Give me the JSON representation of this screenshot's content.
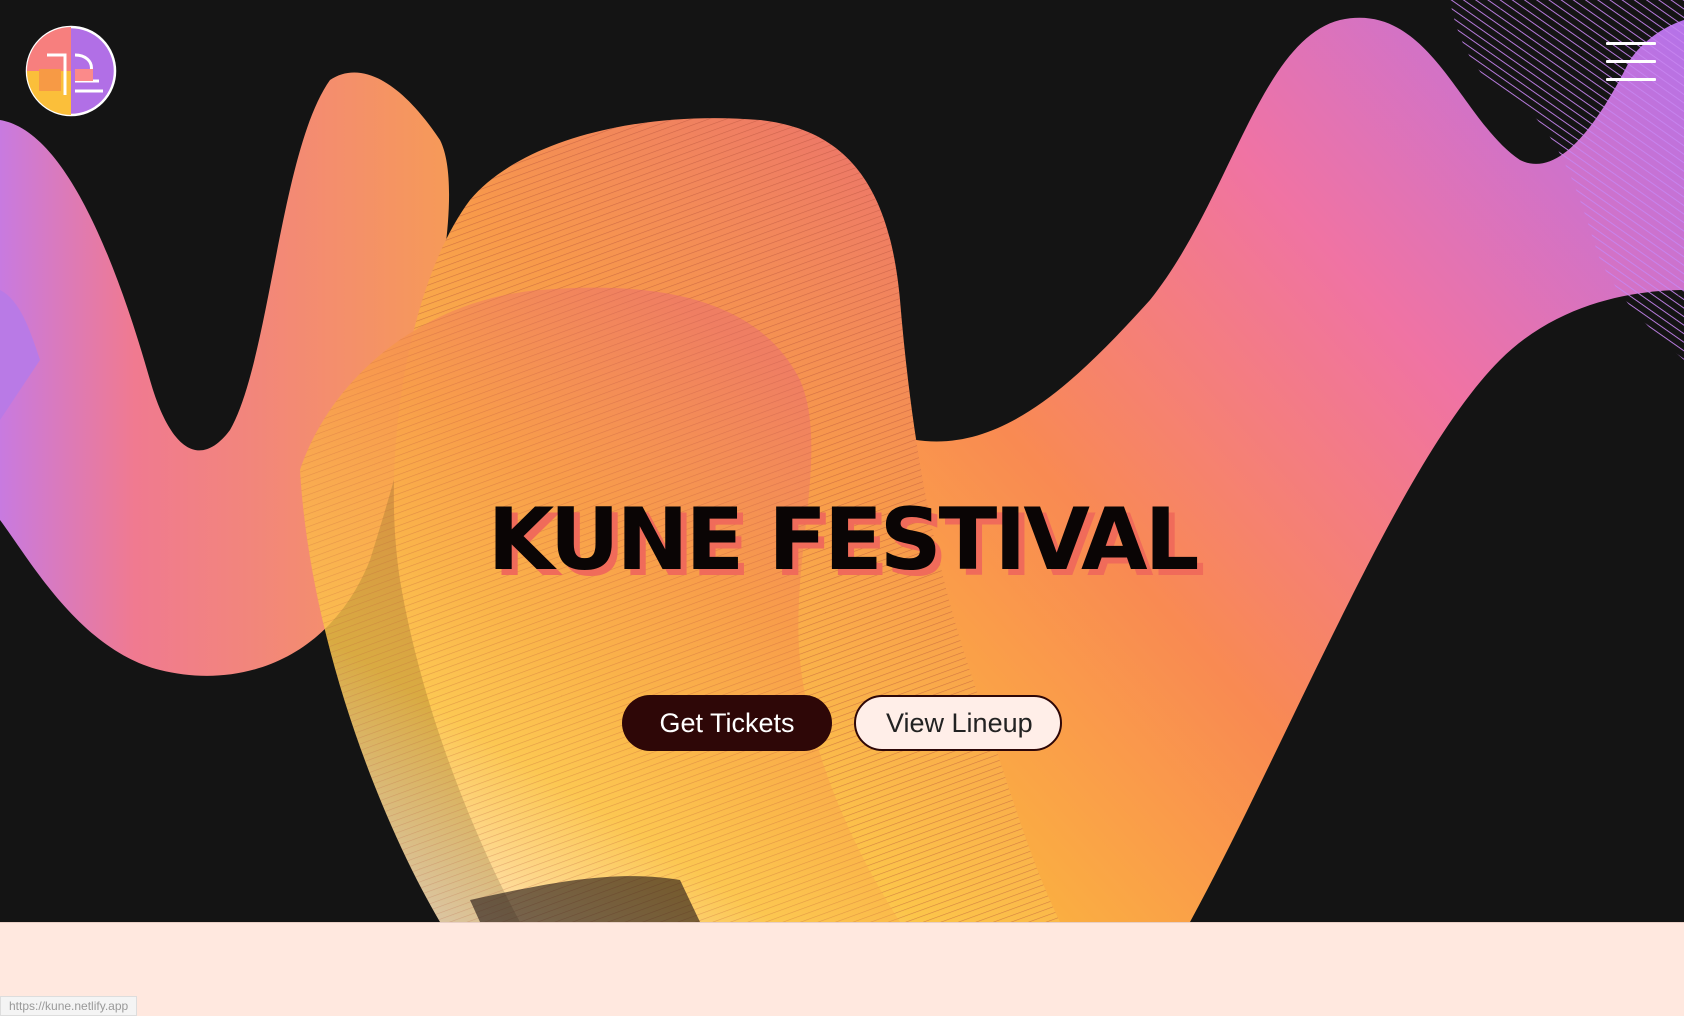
{
  "header": {
    "logo_icon": "kune-logo-icon",
    "menu_icon": "hamburger-menu-icon"
  },
  "hero": {
    "title": "KUNE FESTIVAL",
    "primary_cta": "Get Tickets",
    "secondary_cta": "View Lineup"
  },
  "status_bar": {
    "url": "https://kune.netlify.app"
  },
  "colors": {
    "background_dark": "#141414",
    "accent_orange": "#f79a45",
    "accent_pink": "#f070a0",
    "accent_purple": "#b070e8",
    "accent_yellow": "#fbc03a",
    "title_shadow": "#f06b5a",
    "button_dark": "#2e0707",
    "page_light": "#ffe8df"
  }
}
